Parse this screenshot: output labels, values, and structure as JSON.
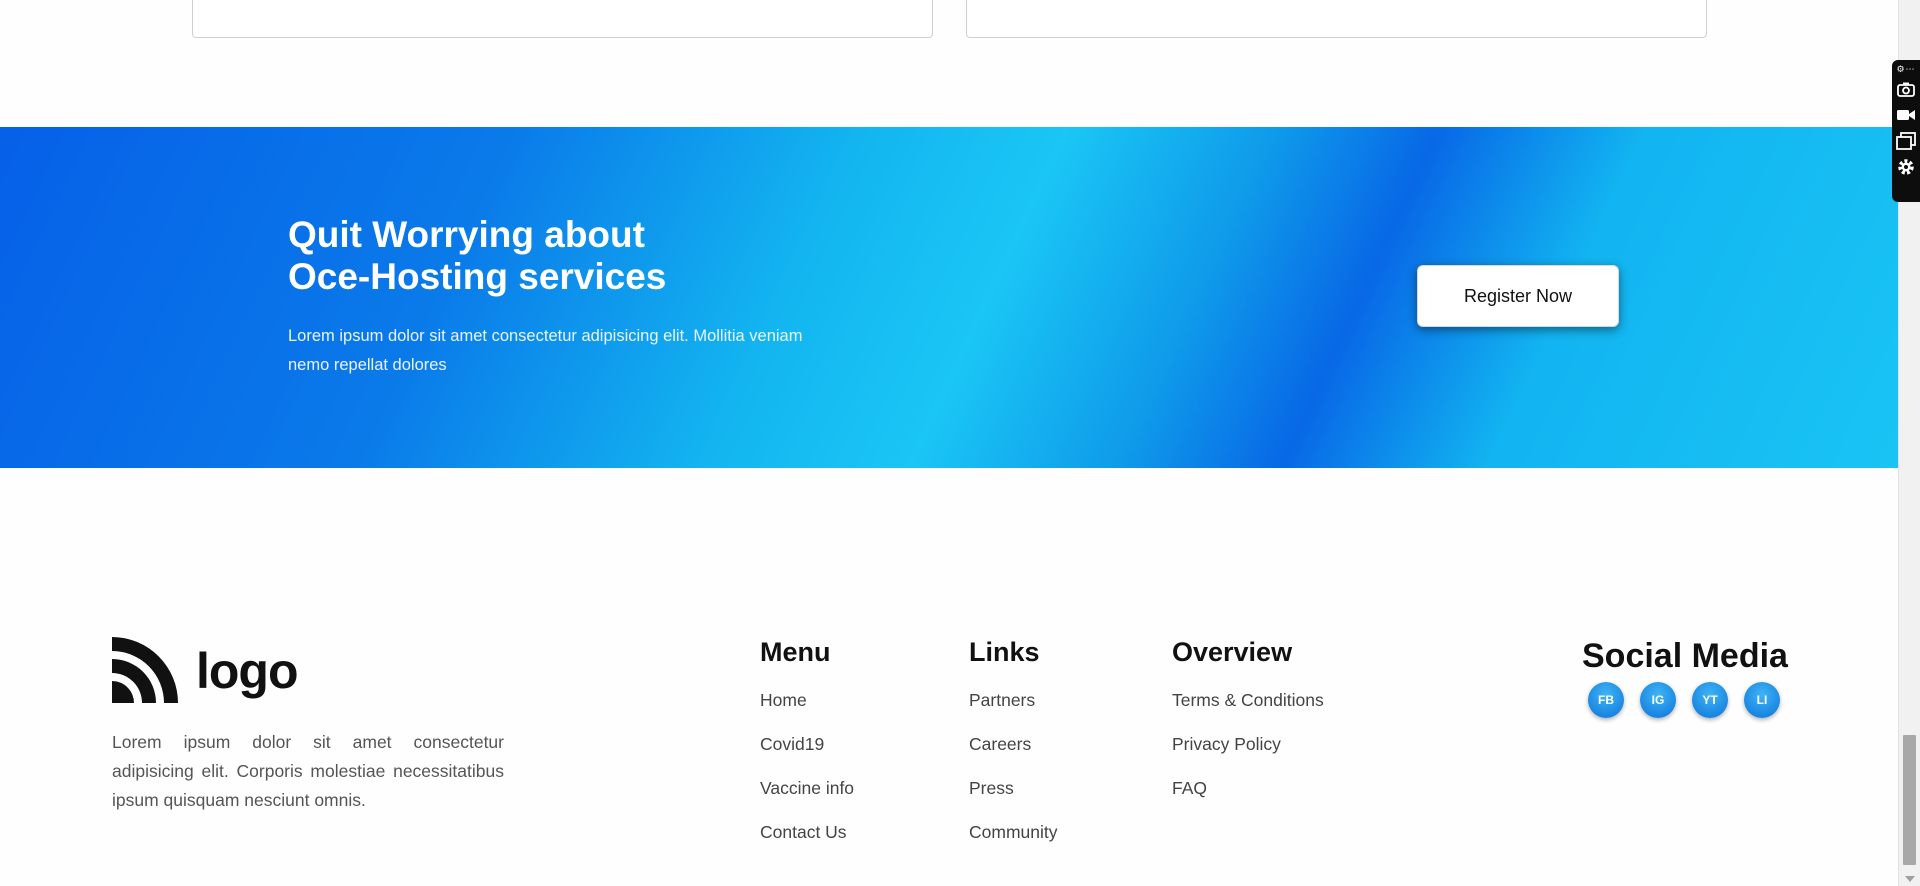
{
  "cta": {
    "title_line1": "Quit Worrying about",
    "title_line2": "Oce-Hosting services",
    "description": "Lorem ipsum dolor sit amet consectetur adipisicing elit. Mollitia veniam nemo repellat dolores",
    "button_label": "Register Now"
  },
  "footer": {
    "logo_text": "logo",
    "description": "Lorem ipsum dolor sit amet consectetur adipisicing elit. Corporis molestiae necessitatibus ipsum quisquam nesciunt omnis.",
    "menu": {
      "heading": "Menu",
      "items": [
        "Home",
        "Covid19",
        "Vaccine info",
        "Contact Us"
      ]
    },
    "links": {
      "heading": "Links",
      "items": [
        "Partners",
        "Careers",
        "Press",
        "Community"
      ]
    },
    "overview": {
      "heading": "Overview",
      "items": [
        "Terms & Conditions",
        "Privacy Policy",
        "FAQ"
      ]
    },
    "social": {
      "heading": "Social Media",
      "icons": [
        "FB",
        "IG",
        "YT",
        "LI"
      ]
    }
  },
  "extension_toolbar": {
    "icons": [
      "camera-icon",
      "video-icon",
      "windows-icon",
      "gear-icon"
    ]
  },
  "colors": {
    "cta_gradient_start": "#0660e8",
    "cta_gradient_light": "#1ac6f5",
    "social_icon": "#1a8fe8",
    "text_dark": "#111111",
    "text_muted": "#555555"
  }
}
